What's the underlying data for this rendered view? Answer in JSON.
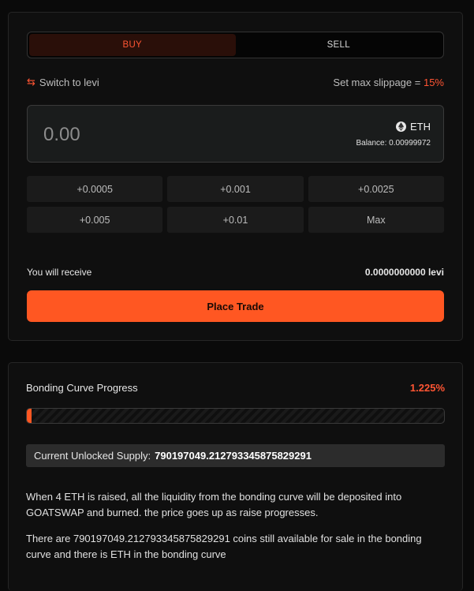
{
  "trade": {
    "tabs": {
      "buy": "BUY",
      "sell": "SELL"
    },
    "switch_label": "Switch to levi",
    "switch_icon": "swap-arrows-icon",
    "slippage_label": "Set max slippage = ",
    "slippage_value": "15%",
    "amount_placeholder": "0.00",
    "token_symbol": "ETH",
    "token_icon": "ethereum-icon",
    "balance": "Balance: 0.00999972",
    "quick_amounts": [
      "+0.0005",
      "+0.001",
      "+0.0025",
      "+0.005",
      "+0.01",
      "Max"
    ],
    "receive_label": "You will receive",
    "receive_value": "0.0000000000 levi",
    "place_trade": "Place Trade",
    "accent_color": "#ff5722"
  },
  "bonding_curve": {
    "title": "Bonding Curve Progress",
    "progress_text": "1.225%",
    "progress_value": 0.01225,
    "supply_label": "Current Unlocked Supply:",
    "supply_value": "790197049.212793345875829291",
    "description_1": "When 4 ETH is raised, all the liquidity from the bonding curve will be deposited into GOATSWAP and burned. the price goes up as raise progresses.",
    "description_2": "There are 790197049.212793345875829291 coins still available for sale in the bonding curve and there is ETH in the bonding curve"
  }
}
